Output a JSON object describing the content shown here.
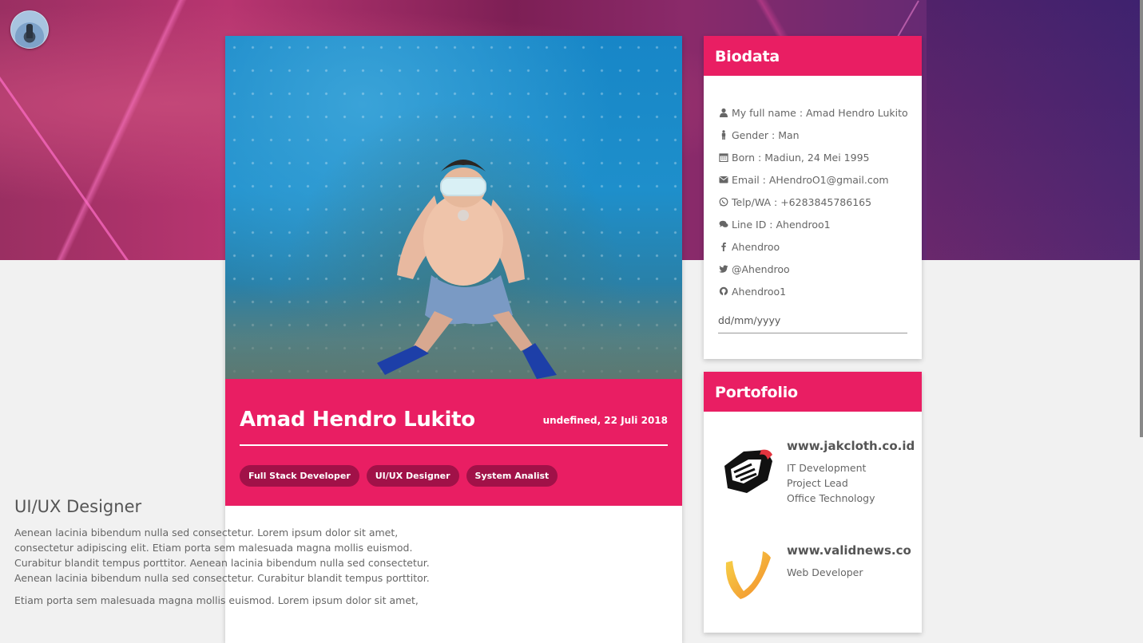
{
  "profile": {
    "name": "Amad Hendro Lukito",
    "date": "undefined, 22 Juli 2018",
    "tags": [
      "Full Stack Developer",
      "UI/UX Designer",
      "System Analist"
    ]
  },
  "section": {
    "title": "UI/UX Designer",
    "paragraphs": [
      "Aenean lacinia bibendum nulla sed consectetur. Lorem ipsum dolor sit amet, consectetur adipiscing elit. Etiam porta sem malesuada magna mollis euismod. Curabitur blandit tempus porttitor. Aenean lacinia bibendum nulla sed consectetur. Aenean lacinia bibendum nulla sed consectetur. Curabitur blandit tempus porttitor.",
      "Etiam porta sem malesuada magna mollis euismod. Lorem ipsum dolor sit amet,"
    ]
  },
  "biodata": {
    "title": "Biodata",
    "rows": [
      {
        "icon": "user-icon",
        "text": "My full name : Amad Hendro Lukito"
      },
      {
        "icon": "male-icon",
        "text": "Gender : Man"
      },
      {
        "icon": "calendar-icon",
        "text": "Born : Madiun, 24 Mei 1995"
      },
      {
        "icon": "envelope-icon",
        "text": "Email : AHendroO1@gmail.com"
      },
      {
        "icon": "whatsapp-icon",
        "text": "Telp/WA : +6283845786165"
      },
      {
        "icon": "comments-icon",
        "text": "Line ID : Ahendroo1"
      },
      {
        "icon": "facebook-icon",
        "text": "Ahendroo"
      },
      {
        "icon": "twitter-icon",
        "text": "@Ahendroo"
      },
      {
        "icon": "github-icon",
        "text": "Ahendroo1"
      }
    ],
    "date_placeholder": "dd/mm/yyyy"
  },
  "portfolio": {
    "title": "Portofolio",
    "items": [
      {
        "site": "www.jakcloth.co.id",
        "roles": [
          "IT Development",
          "Project Lead",
          "Office Technology"
        ]
      },
      {
        "site": "www.validnews.co",
        "roles": [
          "Web Developer"
        ]
      }
    ]
  },
  "colors": {
    "accent": "#e91e63",
    "tag_bg": "#a11148"
  }
}
